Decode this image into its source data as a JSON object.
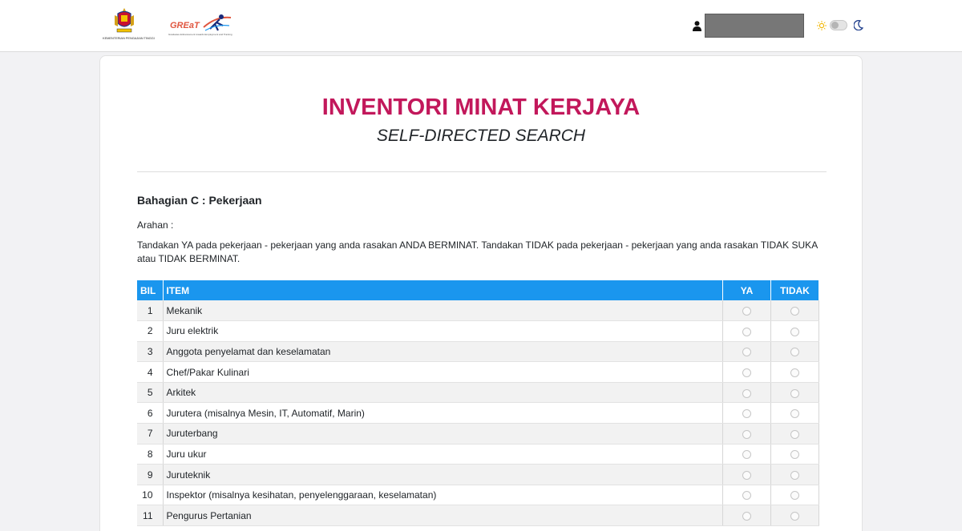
{
  "header": {
    "crest_caption": "KEMENTERIAN PENGAJIAN TINGGI",
    "great_logo_text": "GREaT",
    "great_tagline": "Graduates Enhancement towards Employment and Training",
    "user_name": "",
    "theme_icons": [
      "sun-icon",
      "moon-icon"
    ]
  },
  "page": {
    "title": "INVENTORI MINAT KERJAYA",
    "subtitle": "SELF-DIRECTED SEARCH",
    "section": "Bahagian C : Pekerjaan",
    "instruction_label": "Arahan :",
    "instruction_text": "Tandakan YA pada pekerjaan - pekerjaan yang anda rasakan ANDA BERMINAT. Tandakan TIDAK pada pekerjaan - pekerjaan yang anda rasakan TIDAK SUKA atau TIDAK BERMINAT."
  },
  "table": {
    "headers": {
      "bil": "BIL",
      "item": "ITEM",
      "ya": "YA",
      "tidak": "TIDAK"
    },
    "rows": [
      {
        "bil": "1",
        "item": "Mekanik"
      },
      {
        "bil": "2",
        "item": "Juru elektrik"
      },
      {
        "bil": "3",
        "item": "Anggota penyelamat dan keselamatan"
      },
      {
        "bil": "4",
        "item": "Chef/Pakar Kulinari"
      },
      {
        "bil": "5",
        "item": "Arkitek"
      },
      {
        "bil": "6",
        "item": "Jurutera (misalnya Mesin, IT, Automatif, Marin)"
      },
      {
        "bil": "7",
        "item": "Juruterbang"
      },
      {
        "bil": "8",
        "item": "Juru ukur"
      },
      {
        "bil": "9",
        "item": "Juruteknik"
      },
      {
        "bil": "10",
        "item": "Inspektor (misalnya kesihatan, penyelenggaraan, keselamatan)"
      },
      {
        "bil": "11",
        "item": "Pengurus Pertanian"
      }
    ]
  },
  "colors": {
    "title": "#c2185b",
    "table_header": "#1a96ee"
  }
}
